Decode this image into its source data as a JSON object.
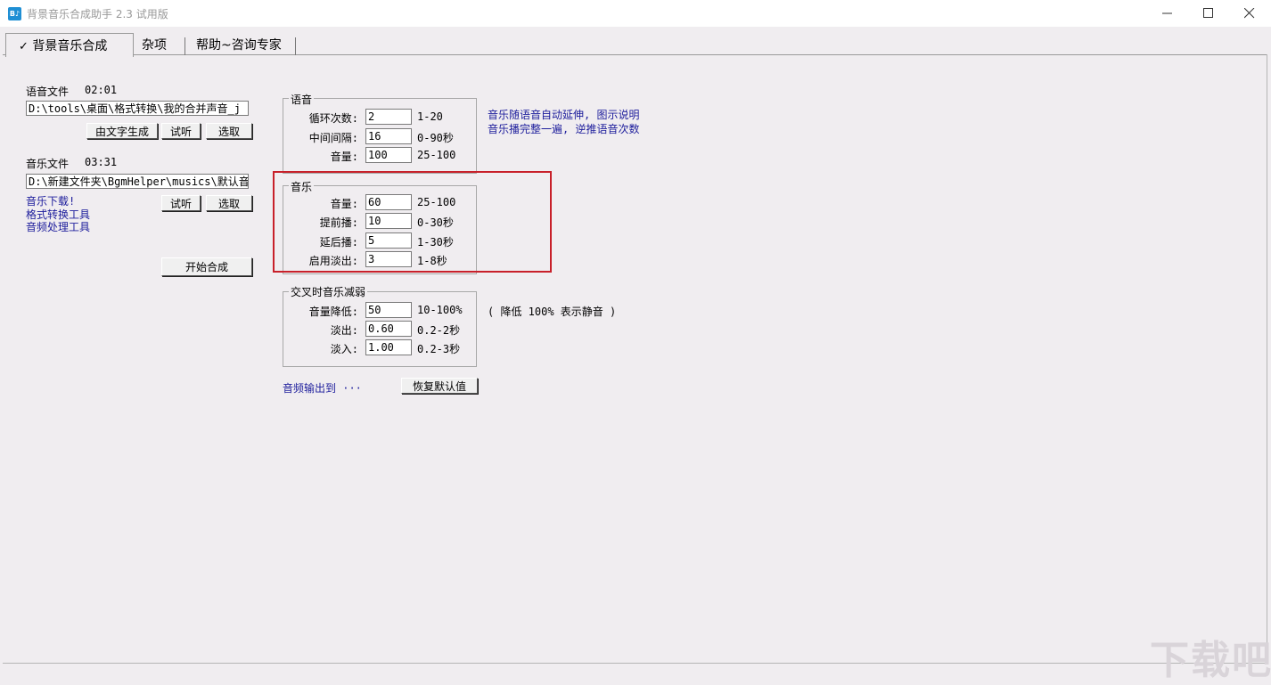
{
  "window": {
    "title": "背景音乐合成助手 2.3 试用版",
    "icon_text": "B♪"
  },
  "tabs": [
    {
      "label": "背景音乐合成",
      "check": "✓",
      "active": true
    },
    {
      "label": "杂项",
      "active": false
    },
    {
      "label": "帮助~咨询专家",
      "active": false
    }
  ],
  "left": {
    "voice_label": "语音文件",
    "voice_duration": "02:01",
    "voice_path": "D:\\tools\\桌面\\格式转换\\我的合并声音_j",
    "btn_text_gen": "由文字生成",
    "btn_listen": "试听",
    "btn_select": "选取",
    "music_label": "音乐文件",
    "music_duration": "03:31",
    "music_path": "D:\\新建文件夹\\BgmHelper\\musics\\默认音",
    "link_download": "音乐下载!",
    "link_convert": "格式转换工具",
    "link_process": "音频处理工具",
    "btn_start": "开始合成"
  },
  "voice_group": {
    "title": "语音",
    "rows": [
      {
        "label": "循环次数:",
        "value": "2",
        "range": "1-20"
      },
      {
        "label": "中间间隔:",
        "value": "16",
        "range": "0-90秒"
      },
      {
        "label": "音量:",
        "value": "100",
        "range": "25-100"
      }
    ],
    "note_line1": "音乐随语音自动延伸, 图示说明",
    "note_line2": "音乐播完整一遍, 逆推语音次数"
  },
  "music_group": {
    "title": "音乐",
    "rows": [
      {
        "label": "音量:",
        "value": "60",
        "range": "25-100"
      },
      {
        "label": "提前播:",
        "value": "10",
        "range": "0-30秒"
      },
      {
        "label": "延后播:",
        "value": "5",
        "range": "1-30秒"
      },
      {
        "label": "启用淡出:",
        "value": "3",
        "range": "1-8秒"
      }
    ]
  },
  "cross_group": {
    "title": "交叉时音乐减弱",
    "rows": [
      {
        "label": "音量降低:",
        "value": "50",
        "range": "10-100%"
      },
      {
        "label": "淡出:",
        "value": "0.60",
        "range": "0.2-2秒"
      },
      {
        "label": "淡入:",
        "value": "1.00",
        "range": "0.2-3秒"
      }
    ],
    "note": "( 降低 100% 表示静音 )"
  },
  "output_link": "音频输出到 ···",
  "btn_restore": "恢复默认值",
  "watermark": "下载吧",
  "colors": {
    "highlight": "#c8202a",
    "link": "#1d1d9c"
  }
}
